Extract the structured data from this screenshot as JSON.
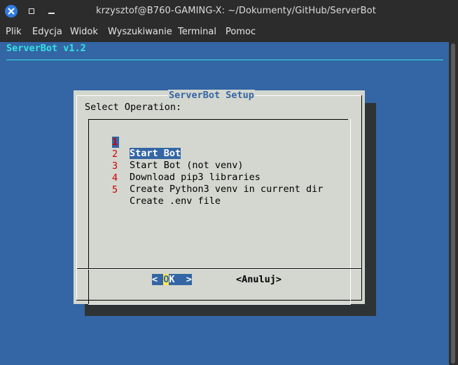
{
  "window": {
    "title": "krzysztof@B760-GAMING-X: ~/Dokumenty/GitHub/ServerBot",
    "controls": [
      "close-icon",
      "maximize-icon",
      "minimize-icon"
    ]
  },
  "menubar": {
    "items": [
      "Plik",
      "Edycja",
      "Widok",
      "Wyszukiwanie",
      "Terminal",
      "Pomoc"
    ]
  },
  "terminal": {
    "backtitle": "ServerBot v1.2",
    "colors": {
      "background": "#3465a4",
      "backtitle": "#34e2e2",
      "dialog": "#d3d7cf",
      "shadow": "#2e3436",
      "tag": "#cc0000",
      "hotkey": "#fce94f"
    }
  },
  "dialog": {
    "title": "ServerBot Setup",
    "prompt": "Select Operation:",
    "items": [
      {
        "tag": "1",
        "label": "Start Bot",
        "selected": true
      },
      {
        "tag": "2",
        "label": "Start Bot (not venv)",
        "selected": false
      },
      {
        "tag": "3",
        "label": "Download pip3 libraries",
        "selected": false
      },
      {
        "tag": "4",
        "label": "Create Python3 venv in current dir",
        "selected": false
      },
      {
        "tag": "5",
        "label": "Create .env file",
        "selected": false
      }
    ],
    "buttons": {
      "ok_left": "< ",
      "ok_hot": "O",
      "ok_rest": "K  >",
      "cancel": "<Anuluj>"
    }
  }
}
